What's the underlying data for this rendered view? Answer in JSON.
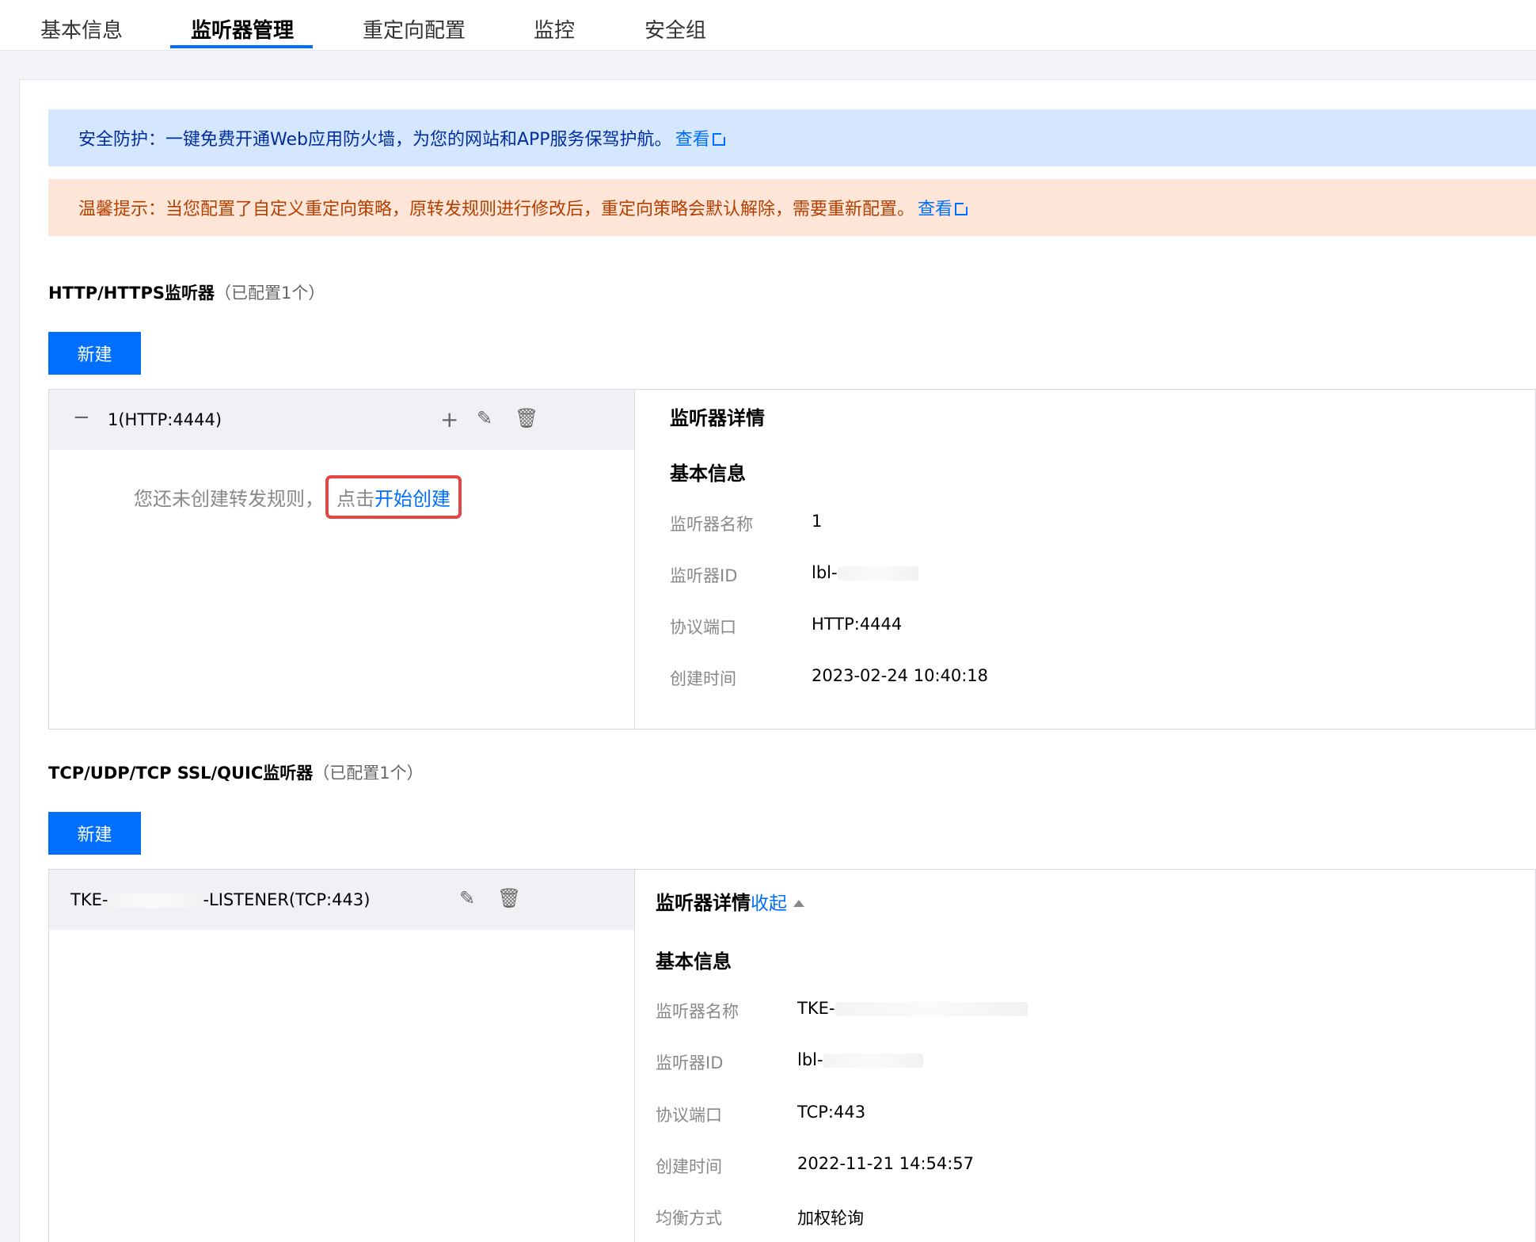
{
  "tabs": [
    "基本信息",
    "监听器管理",
    "重定向配置",
    "监控",
    "安全组"
  ],
  "notices": {
    "info_text": "安全防护：一键免费开通Web应用防火墙，为您的网站和APP服务保驾护航。",
    "info_link": "查看",
    "warn_text": "温馨提示：当您配置了自定义重定向策略，原转发规则进行修改后，重定向策略会默认解除，需要重新配置。",
    "warn_link": "查看"
  },
  "http_section": {
    "title": "HTTP/HTTPS监听器",
    "count": "（已配置1个）",
    "new_label": "新建",
    "listener_name": "1(HTTP:4444)",
    "empty_text": "您还未创建转发规则，",
    "empty_click": "点击",
    "empty_link": "开始创建",
    "detail_title": "监听器详情",
    "basic_info": "基本信息",
    "fields": [
      {
        "label": "监听器名称",
        "value": "1"
      },
      {
        "label": "监听器ID",
        "value": "lbl-"
      },
      {
        "label": "协议端口",
        "value": "HTTP:4444"
      },
      {
        "label": "创建时间",
        "value": "2023-02-24 10:40:18"
      }
    ]
  },
  "tcp_section": {
    "title": "TCP/UDP/TCP SSL/QUIC监听器",
    "count": "（已配置1个）",
    "new_label": "新建",
    "listener_prefix": "TKE-",
    "listener_suffix": "-LISTENER(TCP:443)",
    "detail_title": "监听器详情",
    "collapse": "收起",
    "basic_info": "基本信息",
    "fields": [
      {
        "label": "监听器名称",
        "value": "TKE-"
      },
      {
        "label": "监听器ID",
        "value": "lbl-"
      },
      {
        "label": "协议端口",
        "value": "TCP:443"
      },
      {
        "label": "创建时间",
        "value": "2022-11-21 14:54:57"
      },
      {
        "label": "均衡方式",
        "value": "加权轮询"
      }
    ]
  },
  "icons": [
    "minus-icon",
    "plus-icon",
    "edit-icon",
    "delete-icon",
    "external-link-icon",
    "caret-up-icon"
  ],
  "colors": {
    "primary": "#006eff",
    "info_bg": "#d5e7ff",
    "warn_bg": "#fde6d8",
    "highlight": "#e54545"
  }
}
